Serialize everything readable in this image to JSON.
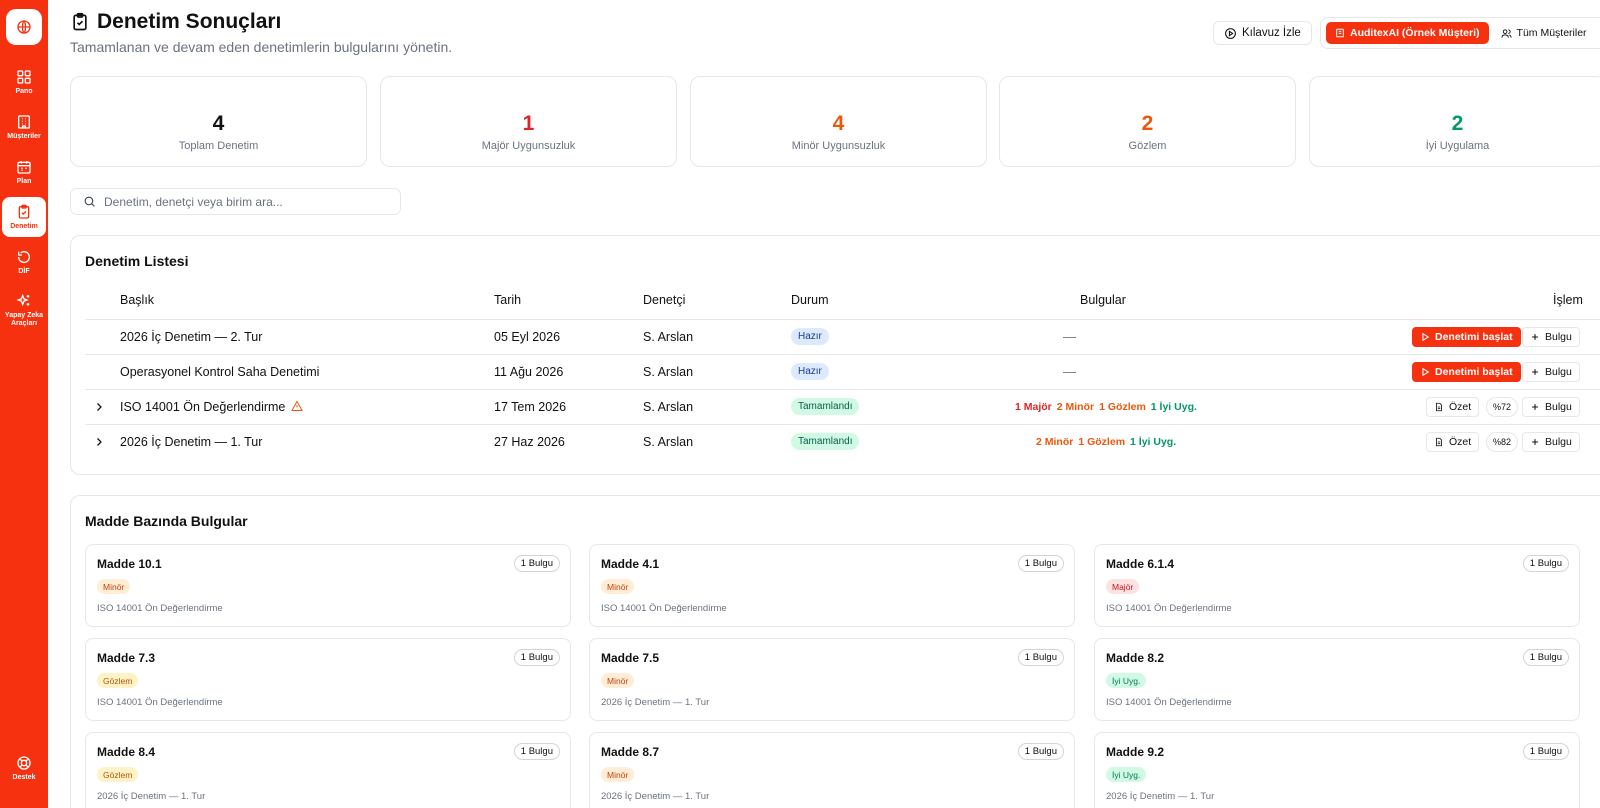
{
  "sidebar": {
    "items": [
      {
        "label": "Pano",
        "icon": "dashboard-icon"
      },
      {
        "label": "Müşteriler",
        "icon": "building-icon"
      },
      {
        "label": "Plan",
        "icon": "calendar-icon"
      },
      {
        "label": "Denetim",
        "icon": "clipboard-check-icon",
        "active": true
      },
      {
        "label": "DİF",
        "icon": "refresh-icon"
      },
      {
        "label": "Yapay Zeka Araçları",
        "icon": "sparkles-icon"
      }
    ],
    "support_label": "Destek"
  },
  "header": {
    "title": "Denetim Sonuçları",
    "subtitle": "Tamamlanan ve devam eden denetimlerin bulgularını yönetin.",
    "guide_button": "Kılavuz İzle",
    "active_client": "AuditexAI (Örnek Müşteri)",
    "all_clients": "Tüm Müşteriler"
  },
  "stats": [
    {
      "value": "4",
      "label": "Toplam Denetim",
      "color": "#111111"
    },
    {
      "value": "1",
      "label": "Majör Uygunsuzluk",
      "color": "#dc2626"
    },
    {
      "value": "4",
      "label": "Minör Uygunsuzluk",
      "color": "#ea580c"
    },
    {
      "value": "2",
      "label": "Gözlem",
      "color": "#ea580c"
    },
    {
      "value": "2",
      "label": "İyi Uygulama",
      "color": "#059669"
    }
  ],
  "search": {
    "placeholder": "Denetim, denetçi veya birim ara..."
  },
  "audit_list": {
    "title": "Denetim Listesi",
    "columns": {
      "title": "Başlık",
      "date": "Tarih",
      "auditor": "Denetçi",
      "status": "Durum",
      "findings": "Bulgular",
      "action": "İşlem"
    },
    "rows": [
      {
        "title": "2026 İç Denetim — 2. Tur",
        "date": "05 Eyl 2026",
        "auditor": "S. Arslan",
        "status": "Hazır",
        "findings_empty": "—",
        "start_label": "Denetimi başlat",
        "add_label": "Bulgu"
      },
      {
        "title": "Operasyonel Kontrol Saha Denetimi",
        "date": "11 Ağu 2026",
        "auditor": "S. Arslan",
        "status": "Hazır",
        "findings_empty": "—",
        "start_label": "Denetimi başlat",
        "add_label": "Bulgu"
      },
      {
        "title": "ISO 14001 Ön Değerlendirme",
        "date": "17 Tem 2026",
        "auditor": "S. Arslan",
        "status": "Tamamlandı",
        "findings": {
          "major": "1 Majör",
          "minor": "2 Minör",
          "gozlem": "1 Gözlem",
          "iyi": "1 İyi Uyg."
        },
        "summary_label": "Özet",
        "score": "%72",
        "add_label": "Bulgu"
      },
      {
        "title": "2026 İç Denetim — 1. Tur",
        "date": "27 Haz 2026",
        "auditor": "S. Arslan",
        "status": "Tamamlandı",
        "findings": {
          "minor": "2 Minör",
          "gozlem": "1 Gözlem",
          "iyi": "1 İyi Uyg."
        },
        "summary_label": "Özet",
        "score": "%82",
        "add_label": "Bulgu"
      }
    ]
  },
  "clauses": {
    "title": "Madde Bazında Bulgular",
    "cards": [
      {
        "clause": "Madde 10.1",
        "count": "1 Bulgu",
        "tag": "Minör",
        "type": "minor",
        "source": "ISO 14001 Ön Değerlendirme"
      },
      {
        "clause": "Madde 4.1",
        "count": "1 Bulgu",
        "tag": "Minör",
        "type": "minor",
        "source": "ISO 14001 Ön Değerlendirme"
      },
      {
        "clause": "Madde 6.1.4",
        "count": "1 Bulgu",
        "tag": "Majör",
        "type": "major",
        "source": "ISO 14001 Ön Değerlendirme"
      },
      {
        "clause": "Madde 7.3",
        "count": "1 Bulgu",
        "tag": "Gözlem",
        "type": "gozlem",
        "source": "ISO 14001 Ön Değerlendirme"
      },
      {
        "clause": "Madde 7.5",
        "count": "1 Bulgu",
        "tag": "Minör",
        "type": "minor",
        "source": "2026 İç Denetim — 1. Tur"
      },
      {
        "clause": "Madde 8.2",
        "count": "1 Bulgu",
        "tag": "İyi Uyg.",
        "type": "iyi",
        "source": "ISO 14001 Ön Değerlendirme"
      },
      {
        "clause": "Madde 8.4",
        "count": "1 Bulgu",
        "tag": "Gözlem",
        "type": "gozlem",
        "source": "2026 İç Denetim — 1. Tur"
      },
      {
        "clause": "Madde 8.7",
        "count": "1 Bulgu",
        "tag": "Minör",
        "type": "minor",
        "source": "2026 İç Denetim — 1. Tur"
      },
      {
        "clause": "Madde 9.2",
        "count": "1 Bulgu",
        "tag": "İyi Uyg.",
        "type": "iyi",
        "source": "2026 İç Denetim — 1. Tur"
      }
    ]
  },
  "colors": {
    "brand": "#f5310f",
    "major": "#dc2626",
    "minor": "#ea580c",
    "good": "#059669"
  }
}
